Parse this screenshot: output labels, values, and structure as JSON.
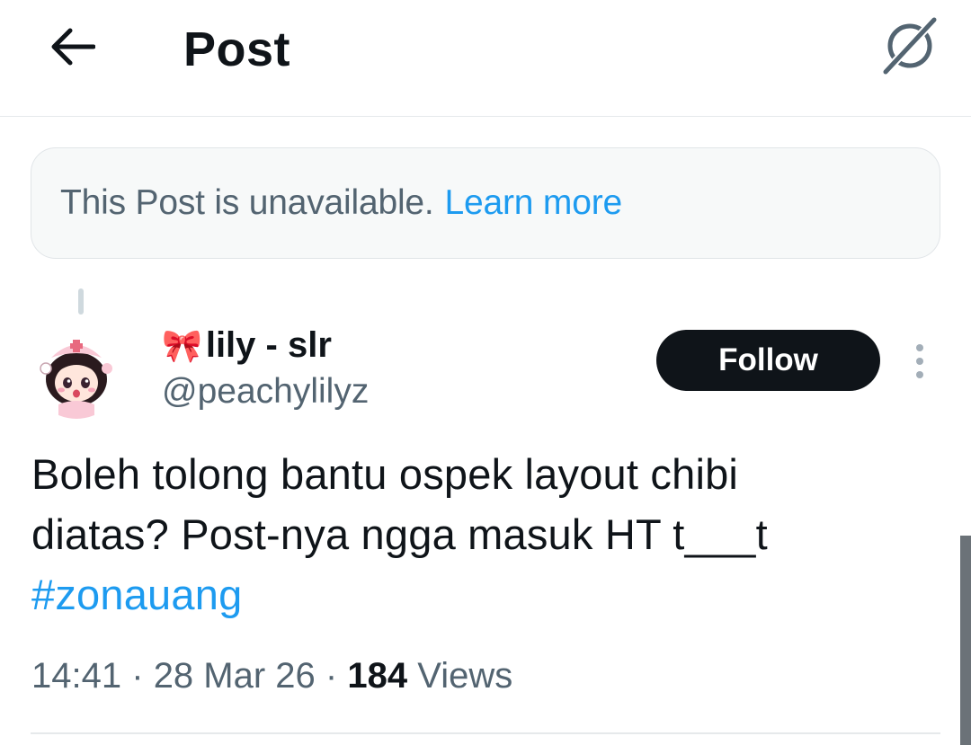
{
  "header": {
    "title": "Post",
    "back_icon": "arrow-left-icon",
    "grok_icon": "grok-icon"
  },
  "notice": {
    "text": "This Post is unavailable.",
    "link": "Learn more"
  },
  "author": {
    "display_name": "lily - slr",
    "name_emoji": "🎀",
    "handle": "@peachylilyz",
    "avatar_icon": "chibi-avatar-icon"
  },
  "actions": {
    "follow_label": "Follow",
    "more_icon": "more-vertical-icon"
  },
  "post": {
    "line1": "Boleh tolong bantu ospek layout chibi",
    "line2": "diatas? Post-nya ngga masuk HT t___t",
    "hashtag": "#zonauang"
  },
  "meta": {
    "time": "14:41",
    "date": "28 Mar 26",
    "separator": "·",
    "views_count": "184",
    "views_label": "Views"
  },
  "colors": {
    "link": "#1d9bf0",
    "secondary_text": "#536471",
    "primary_text": "#0f1419",
    "notice_bg": "#f7f9f9"
  }
}
